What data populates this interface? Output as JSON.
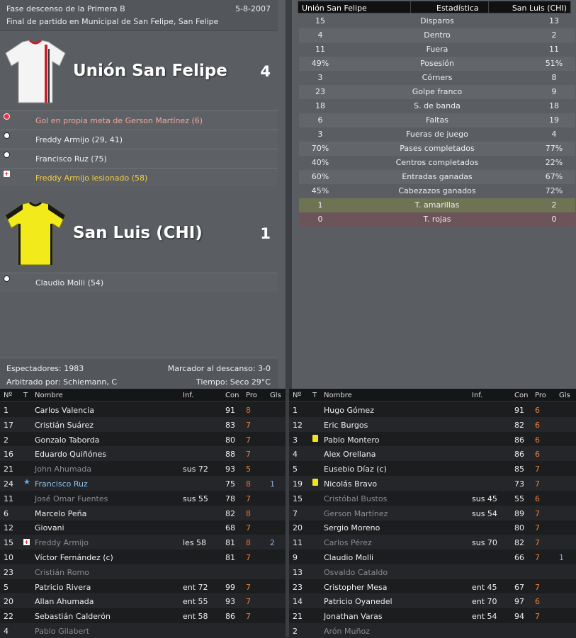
{
  "match": {
    "stage": "Fase descenso de la Primera B",
    "date": "5-8-2007",
    "venue": "Final de partido en Municipal de San Felipe, San Felipe"
  },
  "home": {
    "name": "Unión San Felipe",
    "score": "4",
    "events": [
      {
        "type": "own-goal",
        "text": "Gol en propia meta de Gerson Martínez (6)"
      },
      {
        "type": "goal",
        "text": "Freddy Armijo (29, 41)"
      },
      {
        "type": "goal",
        "text": "Francisco Ruz (75)"
      },
      {
        "type": "injury",
        "text": "Freddy Armijo lesionado (58)"
      }
    ]
  },
  "away": {
    "name": "San Luis (CHI)",
    "score": "1",
    "events": [
      {
        "type": "goal",
        "text": "Claudio Molli (54)"
      }
    ]
  },
  "footer": {
    "spectators": "Espectadores: 1983",
    "halftime": "Marcador al descanso: 3-0",
    "referee": "Arbitrado por: Schiemann, C",
    "weather": "Tiempo: Seco 29°C"
  },
  "stats": {
    "head_home": "Unión San Felipe",
    "head_title": "Estadística",
    "head_away": "San Luis (CHI)",
    "rows": [
      {
        "l": "15",
        "label": "Disparos",
        "r": "13"
      },
      {
        "l": "4",
        "label": "Dentro",
        "r": "2"
      },
      {
        "l": "11",
        "label": "Fuera",
        "r": "11"
      },
      {
        "l": "49%",
        "label": "Posesión",
        "r": "51%"
      },
      {
        "l": "3",
        "label": "Córners",
        "r": "8"
      },
      {
        "l": "23",
        "label": "Golpe franco",
        "r": "9"
      },
      {
        "l": "18",
        "label": "S. de banda",
        "r": "18"
      },
      {
        "l": "6",
        "label": "Faltas",
        "r": "19"
      },
      {
        "l": "3",
        "label": "Fueras de juego",
        "r": "4"
      },
      {
        "l": "70%",
        "label": "Pases completados",
        "r": "77%"
      },
      {
        "l": "40%",
        "label": "Centros completados",
        "r": "22%"
      },
      {
        "l": "60%",
        "label": "Entradas ganadas",
        "r": "67%"
      },
      {
        "l": "45%",
        "label": "Cabezazos ganados",
        "r": "72%"
      },
      {
        "l": "1",
        "label": "T. amarillas",
        "r": "2"
      },
      {
        "l": "0",
        "label": "T. rojas",
        "r": "0"
      }
    ]
  },
  "table_head": {
    "no": "Nº",
    "t": "T",
    "name": "Nombre",
    "inf": "Inf.",
    "con": "Con",
    "pro": "Pro",
    "gls": "Gls"
  },
  "home_players": [
    {
      "no": "1",
      "t": "",
      "name": "Carlos Valencia",
      "inf": "",
      "con": "91",
      "pro": "8",
      "gls": "",
      "sub": false
    },
    {
      "no": "17",
      "t": "",
      "name": "Cristián Suárez",
      "inf": "",
      "con": "83",
      "pro": "7",
      "gls": "",
      "sub": false
    },
    {
      "no": "2",
      "t": "",
      "name": "Gonzalo Taborda",
      "inf": "",
      "con": "80",
      "pro": "7",
      "gls": "",
      "sub": false
    },
    {
      "no": "16",
      "t": "",
      "name": "Eduardo Quiñónes",
      "inf": "",
      "con": "88",
      "pro": "7",
      "gls": "",
      "sub": false
    },
    {
      "no": "21",
      "t": "",
      "name": "John Ahumada",
      "inf": "sus 72",
      "con": "93",
      "pro": "5",
      "gls": "",
      "sub": true
    },
    {
      "no": "24",
      "t": "star",
      "name": "Francisco Ruz",
      "inf": "",
      "con": "75",
      "pro": "8",
      "gls": "1",
      "sub": false,
      "hl": true
    },
    {
      "no": "11",
      "t": "",
      "name": "José Omar Fuentes",
      "inf": "sus 55",
      "con": "78",
      "pro": "7",
      "gls": "",
      "sub": true
    },
    {
      "no": "6",
      "t": "",
      "name": "Marcelo Peña",
      "inf": "",
      "con": "82",
      "pro": "8",
      "gls": "",
      "sub": false
    },
    {
      "no": "12",
      "t": "",
      "name": "Giovani",
      "inf": "",
      "con": "68",
      "pro": "7",
      "gls": "",
      "sub": false
    },
    {
      "no": "15",
      "t": "injury",
      "name": "Freddy Armijo",
      "inf": "les 58",
      "con": "81",
      "pro": "8",
      "gls": "2",
      "sub": true
    },
    {
      "no": "10",
      "t": "",
      "name": "Víctor Fernández (c)",
      "inf": "",
      "con": "81",
      "pro": "7",
      "gls": "",
      "sub": false
    },
    {
      "no": "23",
      "t": "",
      "name": "Cristián Romo",
      "inf": "",
      "con": "",
      "pro": "",
      "gls": "",
      "sub": true
    },
    {
      "no": "5",
      "t": "",
      "name": "Patricio Rivera",
      "inf": "ent 72",
      "con": "99",
      "pro": "7",
      "gls": "",
      "sub": false
    },
    {
      "no": "20",
      "t": "",
      "name": "Allan Ahumada",
      "inf": "ent 55",
      "con": "93",
      "pro": "7",
      "gls": "",
      "sub": false
    },
    {
      "no": "22",
      "t": "",
      "name": "Sebastián Calderón",
      "inf": "ent 58",
      "con": "86",
      "pro": "7",
      "gls": "",
      "sub": false
    },
    {
      "no": "4",
      "t": "",
      "name": "Pablo Gilabert",
      "inf": "",
      "con": "",
      "pro": "",
      "gls": "",
      "sub": true
    }
  ],
  "away_players": [
    {
      "no": "1",
      "t": "",
      "name": "Hugo Gómez",
      "inf": "",
      "con": "91",
      "pro": "6",
      "gls": "",
      "sub": false
    },
    {
      "no": "12",
      "t": "",
      "name": "Eric Burgos",
      "inf": "",
      "con": "82",
      "pro": "6",
      "gls": "",
      "sub": false
    },
    {
      "no": "3",
      "t": "yellow",
      "name": "Pablo Montero",
      "inf": "",
      "con": "86",
      "pro": "6",
      "gls": "",
      "sub": false
    },
    {
      "no": "4",
      "t": "",
      "name": "Alex Orellana",
      "inf": "",
      "con": "86",
      "pro": "6",
      "gls": "",
      "sub": false
    },
    {
      "no": "5",
      "t": "",
      "name": "Eusebio Díaz (c)",
      "inf": "",
      "con": "85",
      "pro": "7",
      "gls": "",
      "sub": false
    },
    {
      "no": "19",
      "t": "yellow",
      "name": "Nicolás Bravo",
      "inf": "",
      "con": "73",
      "pro": "7",
      "gls": "",
      "sub": false
    },
    {
      "no": "15",
      "t": "",
      "name": "Cristóbal Bustos",
      "inf": "sus 45",
      "con": "55",
      "pro": "6",
      "gls": "",
      "sub": true
    },
    {
      "no": "7",
      "t": "",
      "name": "Gerson Martínez",
      "inf": "sus 54",
      "con": "89",
      "pro": "7",
      "gls": "",
      "sub": true
    },
    {
      "no": "20",
      "t": "",
      "name": "Sergio Moreno",
      "inf": "",
      "con": "80",
      "pro": "7",
      "gls": "",
      "sub": false
    },
    {
      "no": "11",
      "t": "",
      "name": "Carlos Pérez",
      "inf": "sus 70",
      "con": "82",
      "pro": "7",
      "gls": "",
      "sub": true
    },
    {
      "no": "9",
      "t": "",
      "name": "Claudio Molli",
      "inf": "",
      "con": "66",
      "pro": "7",
      "gls": "1",
      "sub": false
    },
    {
      "no": "13",
      "t": "",
      "name": "Osvaldo Cataldo",
      "inf": "",
      "con": "",
      "pro": "",
      "gls": "",
      "sub": true
    },
    {
      "no": "23",
      "t": "",
      "name": "Cristopher Mesa",
      "inf": "ent 45",
      "con": "67",
      "pro": "7",
      "gls": "",
      "sub": false
    },
    {
      "no": "14",
      "t": "",
      "name": "Patricio Oyanedel",
      "inf": "ent 70",
      "con": "97",
      "pro": "6",
      "gls": "",
      "sub": false
    },
    {
      "no": "21",
      "t": "",
      "name": "Jonathan Varas",
      "inf": "ent 54",
      "con": "94",
      "pro": "7",
      "gls": "",
      "sub": false
    },
    {
      "no": "2",
      "t": "",
      "name": "Arón Muñoz",
      "inf": "",
      "con": "",
      "pro": "",
      "gls": "",
      "sub": true
    }
  ],
  "colors": {
    "home_shirt": "#f4f4f4",
    "home_stripe": "#c8202a",
    "away_shirt": "#f2ea1a",
    "away_trim": "#1a1a1a"
  }
}
